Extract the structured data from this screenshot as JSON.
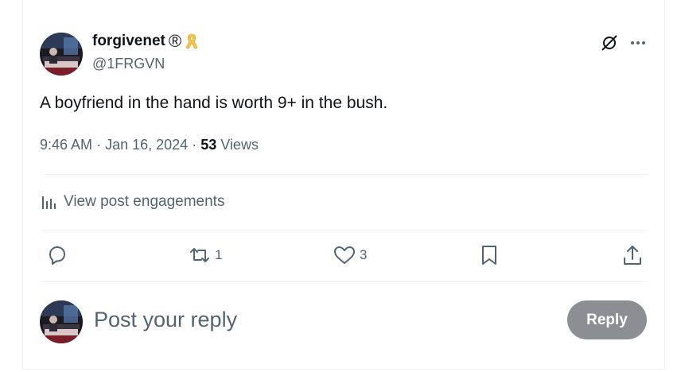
{
  "author": {
    "name": "forgivenet",
    "registered_mark": "®",
    "handle": "@1FRGVN"
  },
  "tweet": {
    "text": "A boyfriend in the hand is worth 9+ in the bush.",
    "time": "9:46 AM",
    "date": "Jan 16, 2024",
    "separator": "·",
    "views_count": "53",
    "views_label": "Views"
  },
  "engagements_label": "View post engagements",
  "actions": {
    "reply_count": "",
    "repost_count": "1",
    "like_count": "3"
  },
  "composer": {
    "placeholder": "Post your reply",
    "reply_button": "Reply"
  },
  "colors": {
    "text": "#0f1419",
    "secondary": "#536471",
    "divider": "#eff3f4",
    "ribbon": "#f5c84b",
    "reply_button_bg": "#8b8f93"
  },
  "icons": {
    "ribbon": "yellow-ribbon-icon",
    "grok": "grok-icon",
    "more": "more-icon",
    "analytics": "analytics-icon",
    "reply": "reply-icon",
    "repost": "repost-icon",
    "like": "like-icon",
    "bookmark": "bookmark-icon",
    "share": "share-icon"
  }
}
